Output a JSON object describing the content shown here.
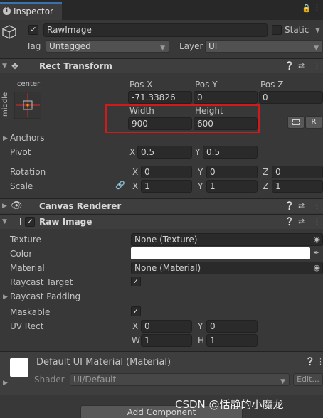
{
  "tab": {
    "title": "Inspector"
  },
  "gameobject": {
    "name": "RawImage",
    "static_label": "Static",
    "tag_label": "Tag",
    "tag_value": "Untagged",
    "layer_label": "Layer",
    "layer_value": "UI"
  },
  "rect": {
    "title": "Rect Transform",
    "anchor_h": "center",
    "anchor_v": "middle",
    "posx_label": "Pos X",
    "posy_label": "Pos Y",
    "posz_label": "Pos Z",
    "posx": "-71.33826",
    "posy": "0",
    "posz": "0",
    "width_label": "Width",
    "height_label": "Height",
    "width": "900",
    "height": "600",
    "r_button": "R",
    "anchors_label": "Anchors",
    "pivot_label": "Pivot",
    "pivot_x": "0.5",
    "pivot_y": "0.5",
    "rotation_label": "Rotation",
    "rot_x": "0",
    "rot_y": "0",
    "rot_z": "0",
    "scale_label": "Scale",
    "scale_x": "1",
    "scale_y": "1",
    "scale_z": "1",
    "x": "X",
    "y": "Y",
    "z": "Z"
  },
  "canvas_renderer": {
    "title": "Canvas Renderer"
  },
  "raw_image": {
    "title": "Raw Image",
    "texture_label": "Texture",
    "texture_value": "None (Texture)",
    "color_label": "Color",
    "color_value": "#ffffff",
    "material_label": "Material",
    "material_value": "None (Material)",
    "raycast_target_label": "Raycast Target",
    "raycast_padding_label": "Raycast Padding",
    "maskable_label": "Maskable",
    "uvrect_label": "UV Rect",
    "uv_x": "0",
    "uv_y": "0",
    "uv_w": "1",
    "uv_h": "1",
    "x": "X",
    "y": "Y",
    "w": "W",
    "h": "H"
  },
  "material": {
    "title": "Default UI Material (Material)",
    "shader_label": "Shader",
    "shader_value": "UI/Default",
    "edit_label": "Edit..."
  },
  "footer": {
    "add_component": "Add Component"
  },
  "watermark": "CSDN @恬静的小魔龙",
  "colors": {
    "accent": "#3a72b0",
    "highlight": "#d21a1a"
  }
}
